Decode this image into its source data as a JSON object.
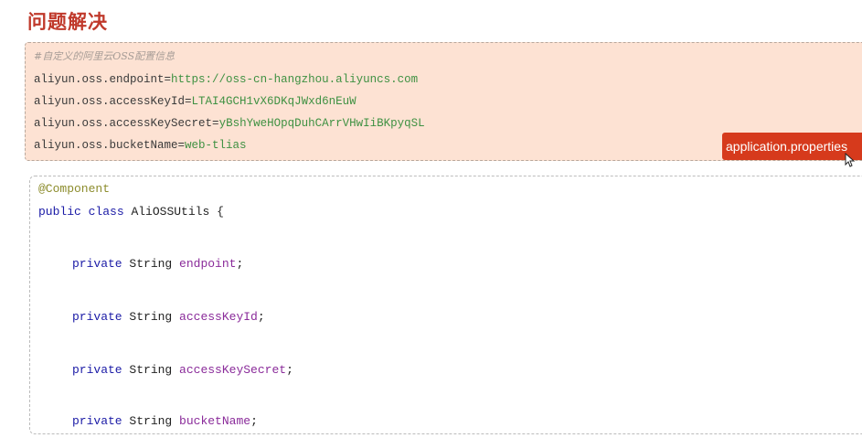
{
  "heading": "问题解决",
  "properties_block": {
    "comment": "#自定义的阿里云OSS配置信息",
    "lines": [
      {
        "key": "aliyun.oss.endpoint",
        "eq": "=",
        "value": "https://oss-cn-hangzhou.aliyuncs.com"
      },
      {
        "key": "aliyun.oss.accessKeyId",
        "eq": "=",
        "value": "LTAI4GCH1vX6DKqJWxd6nEuW"
      },
      {
        "key": "aliyun.oss.accessKeySecret",
        "eq": "=",
        "value": "yBshYweHOpqDuhCArrVHwIiBKpyqSL"
      },
      {
        "key": "aliyun.oss.bucketName",
        "eq": "=",
        "value": "web-tlias"
      }
    ],
    "file_label": "application.properties"
  },
  "code_block": {
    "annotation": "@Component",
    "class_decl": {
      "kw1": "public",
      "kw2": "class",
      "name": "AliOSSUtils",
      "brace": "{"
    },
    "fields": [
      {
        "kw": "private",
        "type": "String",
        "name": "endpoint",
        "end": ";"
      },
      {
        "kw": "private",
        "type": "String",
        "name": "accessKeyId",
        "end": ";"
      },
      {
        "kw": "private",
        "type": "String",
        "name": "accessKeySecret",
        "end": ";"
      },
      {
        "kw": "private",
        "type": "String",
        "name": "bucketName",
        "end": ";"
      }
    ]
  },
  "colors": {
    "heading": "#c0392b",
    "properties_bg": "#fde2d3",
    "badge_bg": "#d63a1c",
    "value_green": "#3f9142",
    "keyword_blue": "#1a1aa6",
    "field_purple": "#8a2b9a"
  }
}
